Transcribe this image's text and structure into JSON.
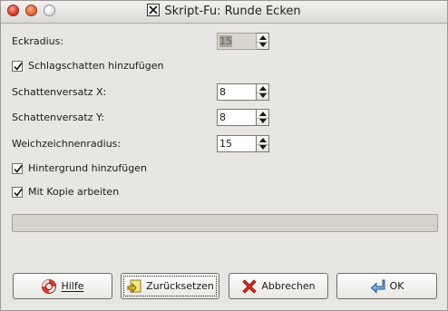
{
  "window": {
    "title": "Skript-Fu: Runde Ecken"
  },
  "fields": {
    "eckradius": {
      "label": "Eckradius:",
      "value": "15"
    },
    "schlagschatten": {
      "label": "Schlagschatten hinzufügen",
      "checked": true
    },
    "versatz_x": {
      "label": "Schattenversatz X:",
      "value": "8"
    },
    "versatz_y": {
      "label": "Schattenversatz Y:",
      "value": "8"
    },
    "weichzeichnen": {
      "label": "Weichzeichnenradius:",
      "value": "15"
    },
    "hintergrund": {
      "label": "Hintergrund hinzufügen",
      "checked": true
    },
    "kopie": {
      "label": "Mit Kopie arbeiten",
      "checked": true
    }
  },
  "progress": {
    "value": 0
  },
  "buttons": {
    "help": {
      "label": "Hilfe",
      "icon": "lifebuoy-icon"
    },
    "reset": {
      "label": "Zurücksetzen",
      "icon": "reset-icon"
    },
    "cancel": {
      "label": "Abbrechen",
      "icon": "cancel-icon"
    },
    "ok": {
      "label": "OK",
      "icon": "return-icon"
    }
  }
}
